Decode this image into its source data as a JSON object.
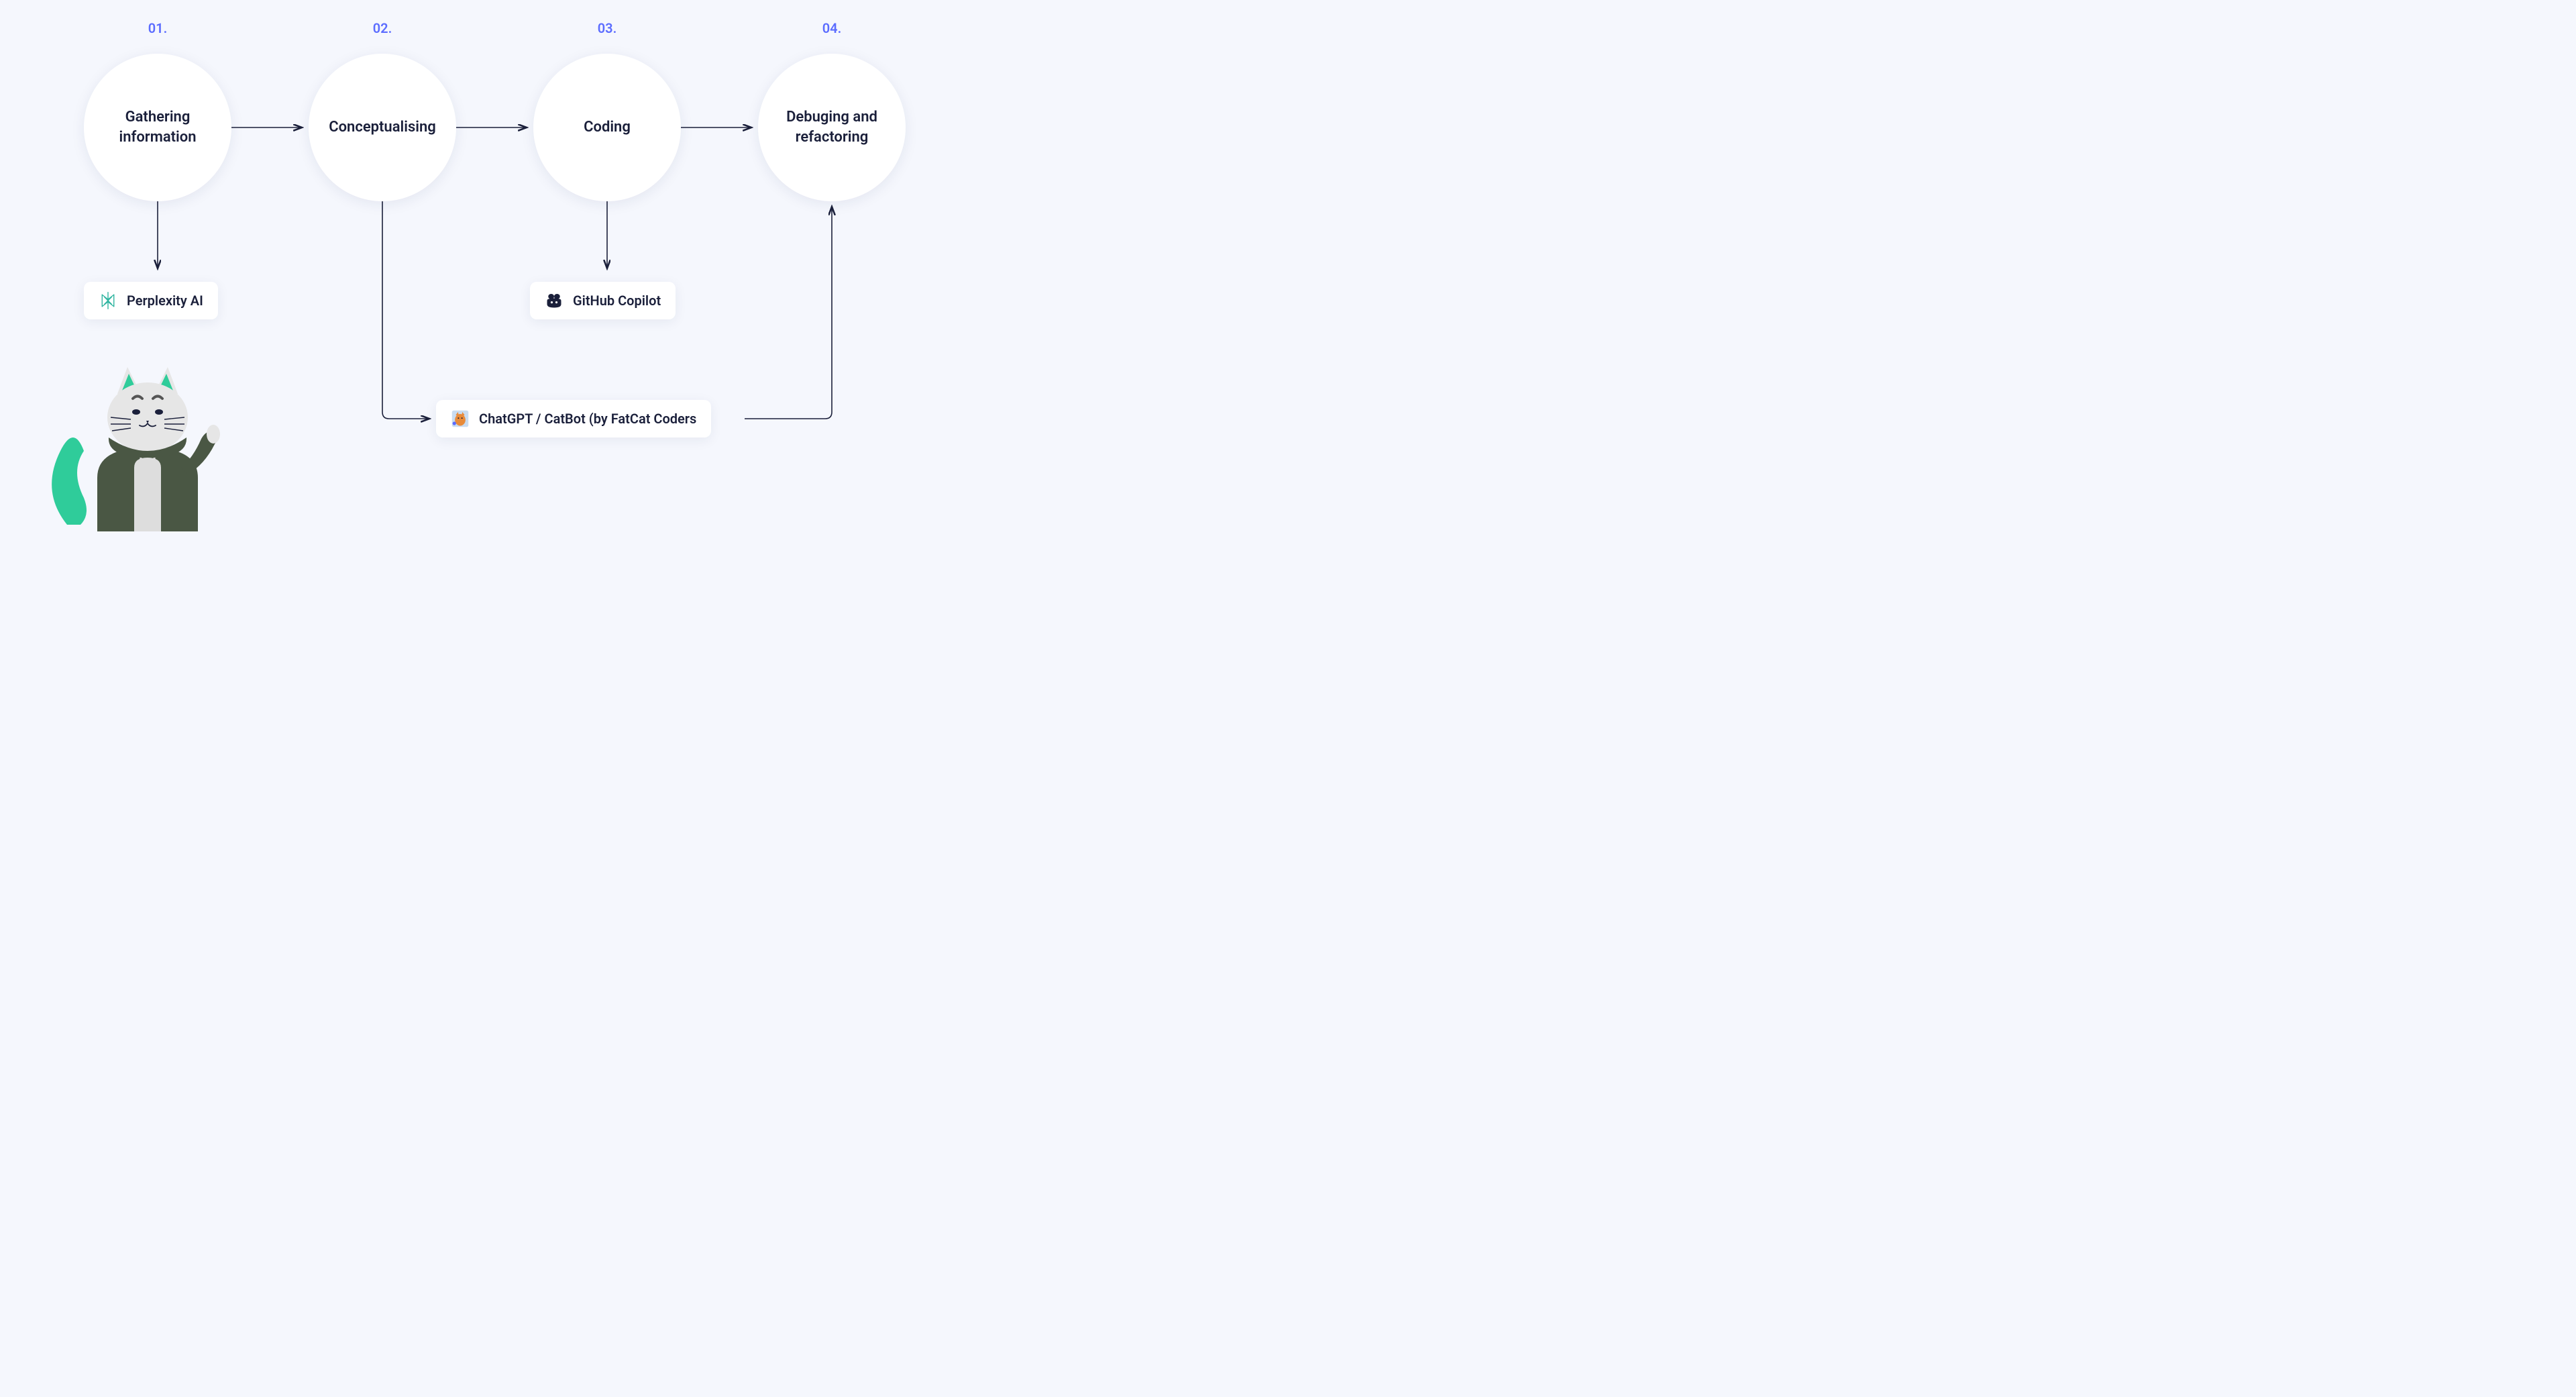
{
  "steps": [
    {
      "num": "01.",
      "label": "Gathering information"
    },
    {
      "num": "02.",
      "label": "Conceptualising"
    },
    {
      "num": "03.",
      "label": "Coding"
    },
    {
      "num": "04.",
      "label": "Debuging and refactoring"
    }
  ],
  "tools": [
    {
      "label": "Perplexity AI",
      "icon": "perplexity"
    },
    {
      "label": "GitHub Copilot",
      "icon": "copilot"
    },
    {
      "label": "ChatGPT / CatBot (by FatCat Coders",
      "icon": "catbot"
    }
  ],
  "colors": {
    "bg": "#f5f7fd",
    "stepNum": "#5b6cff",
    "text": "#1a1f3a",
    "arrow": "#1a1f3a",
    "perplexity": "#2fb5a0",
    "mascotGreen": "#2fcc9a",
    "mascotHoodie": "#4a5744"
  }
}
